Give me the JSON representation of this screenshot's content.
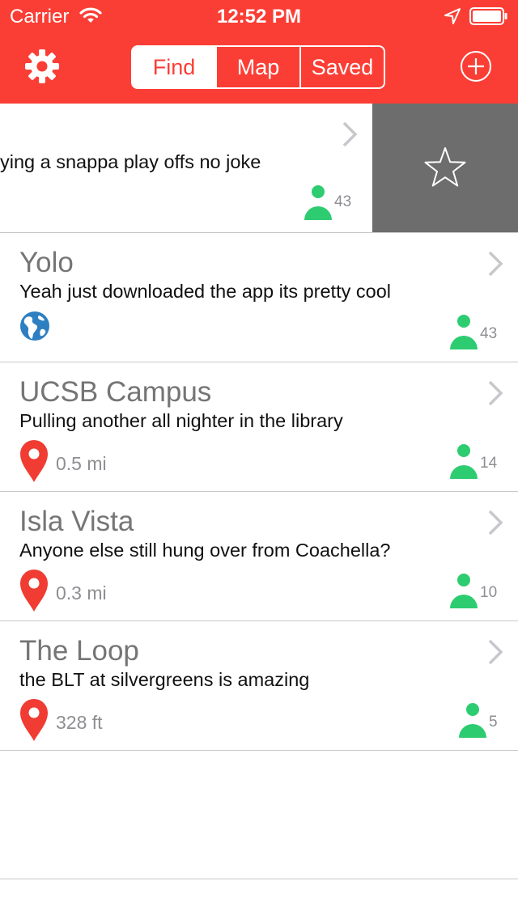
{
  "status_bar": {
    "carrier": "Carrier",
    "time": "12:52 PM"
  },
  "nav": {
    "tabs": [
      {
        "label": "Find",
        "active": true
      },
      {
        "label": "Map",
        "active": false
      },
      {
        "label": "Saved",
        "active": false
      }
    ]
  },
  "colors": {
    "header_red": "#fb3e35",
    "person_green": "#2ecc71",
    "pin_red": "#f03c32",
    "globe_blue": "#2d7fc1",
    "swipe_action_gray": "#6d6d6d"
  },
  "feed": {
    "swiped_row": {
      "message": "ying a snappa play offs no joke",
      "count": "43",
      "action_icon": "star-icon"
    },
    "rows": [
      {
        "title": "Yolo",
        "message": "Yeah just downloaded the app its pretty cool",
        "location_icon": "globe-icon",
        "distance": "",
        "count": "43"
      },
      {
        "title": "UCSB Campus",
        "message": "Pulling another all nighter in the library",
        "location_icon": "pin-icon",
        "distance": "0.5 mi",
        "count": "14"
      },
      {
        "title": "Isla Vista",
        "message": "Anyone else still hung over from Coachella?",
        "location_icon": "pin-icon",
        "distance": "0.3 mi",
        "count": "10"
      },
      {
        "title": "The Loop",
        "message": "the BLT at silvergreens is amazing",
        "location_icon": "pin-icon",
        "distance": "328 ft",
        "count": "5"
      }
    ]
  }
}
